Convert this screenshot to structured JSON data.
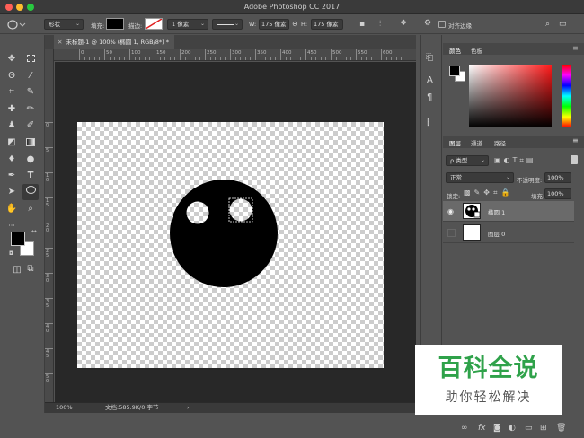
{
  "window": {
    "title": "Adobe Photoshop CC 2017",
    "colors": {
      "close": "#fe5f57",
      "minimize": "#febc2e",
      "zoom": "#28c840"
    }
  },
  "options_bar": {
    "tool_mode": "形状",
    "fill_label": "填充:",
    "stroke_label": "描边:",
    "stroke_width": "1 像素",
    "w_label": "W:",
    "w_value": "175 像素",
    "h_label": "H:",
    "h_value": "175 像素",
    "align_edges_label": "对齐边缘",
    "icons": [
      "ellipse-tool-icon",
      "link-icon",
      "path-ops-icon",
      "path-align-icon",
      "path-arrange-icon",
      "gear-icon",
      "workspace-icon",
      "search-icon"
    ]
  },
  "document": {
    "tab_label": "未标题-1 @ 100% (椭圆 1, RGB/8*) *",
    "ruler_top_numbers": [
      "0",
      "50",
      "100",
      "150",
      "200",
      "250",
      "300",
      "350",
      "400",
      "450",
      "500",
      "550",
      "600"
    ],
    "ruler_left_numbers": [
      "0",
      "5",
      "1 0",
      "1 5",
      "2 0",
      "2 5",
      "3 0",
      "3 5",
      "4 0",
      "4 5",
      "5 0"
    ],
    "colors": {
      "pasteboard": "#282828",
      "shape": "#000000",
      "checker": "#cccccc"
    }
  },
  "status_bar": {
    "zoom": "100%",
    "doc_info": "文档:585.9K/0 字节"
  },
  "tools": [
    "move-tool",
    "marquee-tool",
    "lasso-tool",
    "magic-wand-tool",
    "crop-tool",
    "eyedropper-tool",
    "healing-tool",
    "brush-tool",
    "stamp-tool",
    "history-brush-tool",
    "eraser-tool",
    "gradient-tool",
    "blur-tool",
    "dodge-tool",
    "pen-tool",
    "type-tool",
    "path-select-tool",
    "ellipse-tool",
    "hand-tool",
    "zoom-tool"
  ],
  "tool_glyphs": {
    "type": "T"
  },
  "swatch_colors": {
    "foreground": "#000000",
    "background": "#ffffff"
  },
  "color_panel": {
    "tabs": [
      "颜色",
      "色板"
    ],
    "active_tab": "颜色",
    "colors": {
      "field_hue": "#ff1a1a"
    }
  },
  "layers_panel": {
    "tabs": [
      "图层",
      "通道",
      "路径"
    ],
    "active_tab": "图层",
    "filter_label": "ρ 类型",
    "blend_mode": "正常",
    "opacity_label": "不透明度:",
    "opacity_value": "100%",
    "lock_label": "锁定:",
    "fill_label": "填充:",
    "fill_value": "100%",
    "layers": [
      {
        "name": "椭圆 1",
        "visible": true,
        "selected": true
      },
      {
        "name": "图层 0",
        "visible": false,
        "selected": false
      }
    ],
    "footer_icons": [
      "link-layers-icon",
      "fx-icon",
      "mask-icon",
      "adjustment-icon",
      "group-icon",
      "new-layer-icon",
      "trash-icon"
    ]
  },
  "watermark": {
    "main": "百科全说",
    "sub": "助你轻松解决",
    "color": "#2fa24a"
  }
}
